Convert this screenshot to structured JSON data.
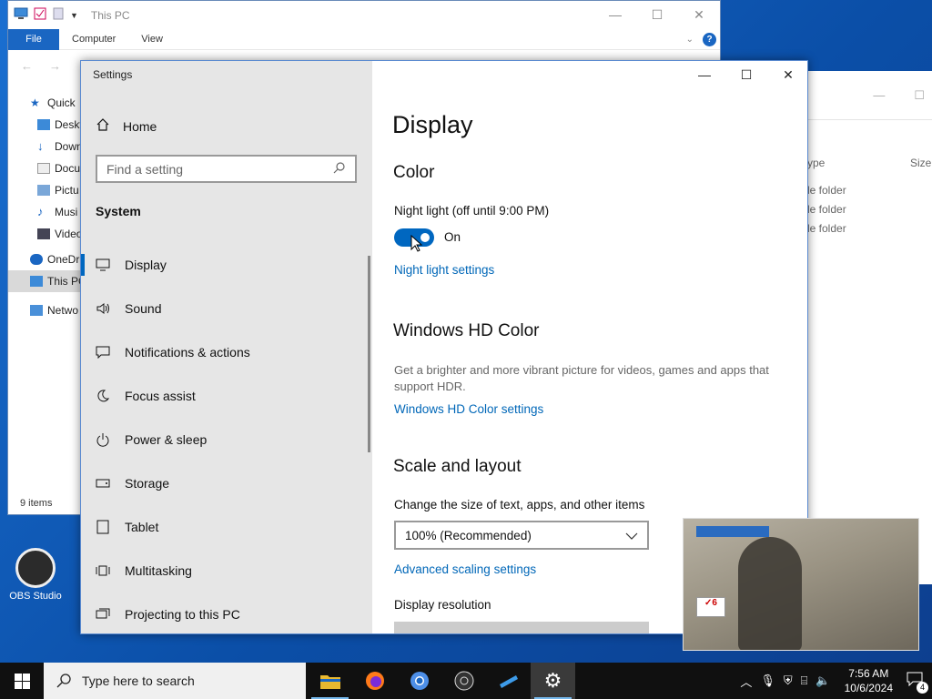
{
  "explorer": {
    "title": "This PC",
    "ribbon_tabs": [
      "File",
      "Computer",
      "View"
    ],
    "tree": [
      "Quick",
      "Deskt",
      "Down",
      "Docu",
      "Pictu",
      "Musi",
      "Video",
      "OneDr",
      "This PC",
      "Netwo"
    ],
    "status": "9 items"
  },
  "back_window": {
    "col_type": "ype",
    "col_size": "Size",
    "rows": [
      "le folder",
      "le folder",
      "le folder"
    ]
  },
  "settings": {
    "window_title": "Settings",
    "home_label": "Home",
    "search_placeholder": "Find a setting",
    "section": "System",
    "nav": [
      {
        "label": "Display",
        "icon": "monitor-icon"
      },
      {
        "label": "Sound",
        "icon": "speaker-icon"
      },
      {
        "label": "Notifications & actions",
        "icon": "message-icon"
      },
      {
        "label": "Focus assist",
        "icon": "moon-icon"
      },
      {
        "label": "Power & sleep",
        "icon": "power-icon"
      },
      {
        "label": "Storage",
        "icon": "storage-icon"
      },
      {
        "label": "Tablet",
        "icon": "tablet-icon"
      },
      {
        "label": "Multitasking",
        "icon": "multitasking-icon"
      },
      {
        "label": "Projecting to this PC",
        "icon": "projector-icon"
      }
    ],
    "page_title": "Display",
    "color_heading": "Color",
    "night_light_label": "Night light (off until 9:00 PM)",
    "toggle_state": "On",
    "night_light_link": "Night light settings",
    "hd_heading": "Windows HD Color",
    "hd_desc": "Get a brighter and more vibrant picture for videos, games and apps that support HDR.",
    "hd_link": "Windows HD Color settings",
    "scale_heading": "Scale and layout",
    "scale_label": "Change the size of text, apps, and other items",
    "scale_value": "100% (Recommended)",
    "adv_link": "Advanced scaling settings",
    "resolution_label": "Display resolution"
  },
  "desktop": {
    "obs_label": "OBS Studio"
  },
  "taskbar": {
    "search_text": "Type here to search",
    "time": "7:56 AM",
    "date": "10/6/2024",
    "notification_count": "4"
  }
}
